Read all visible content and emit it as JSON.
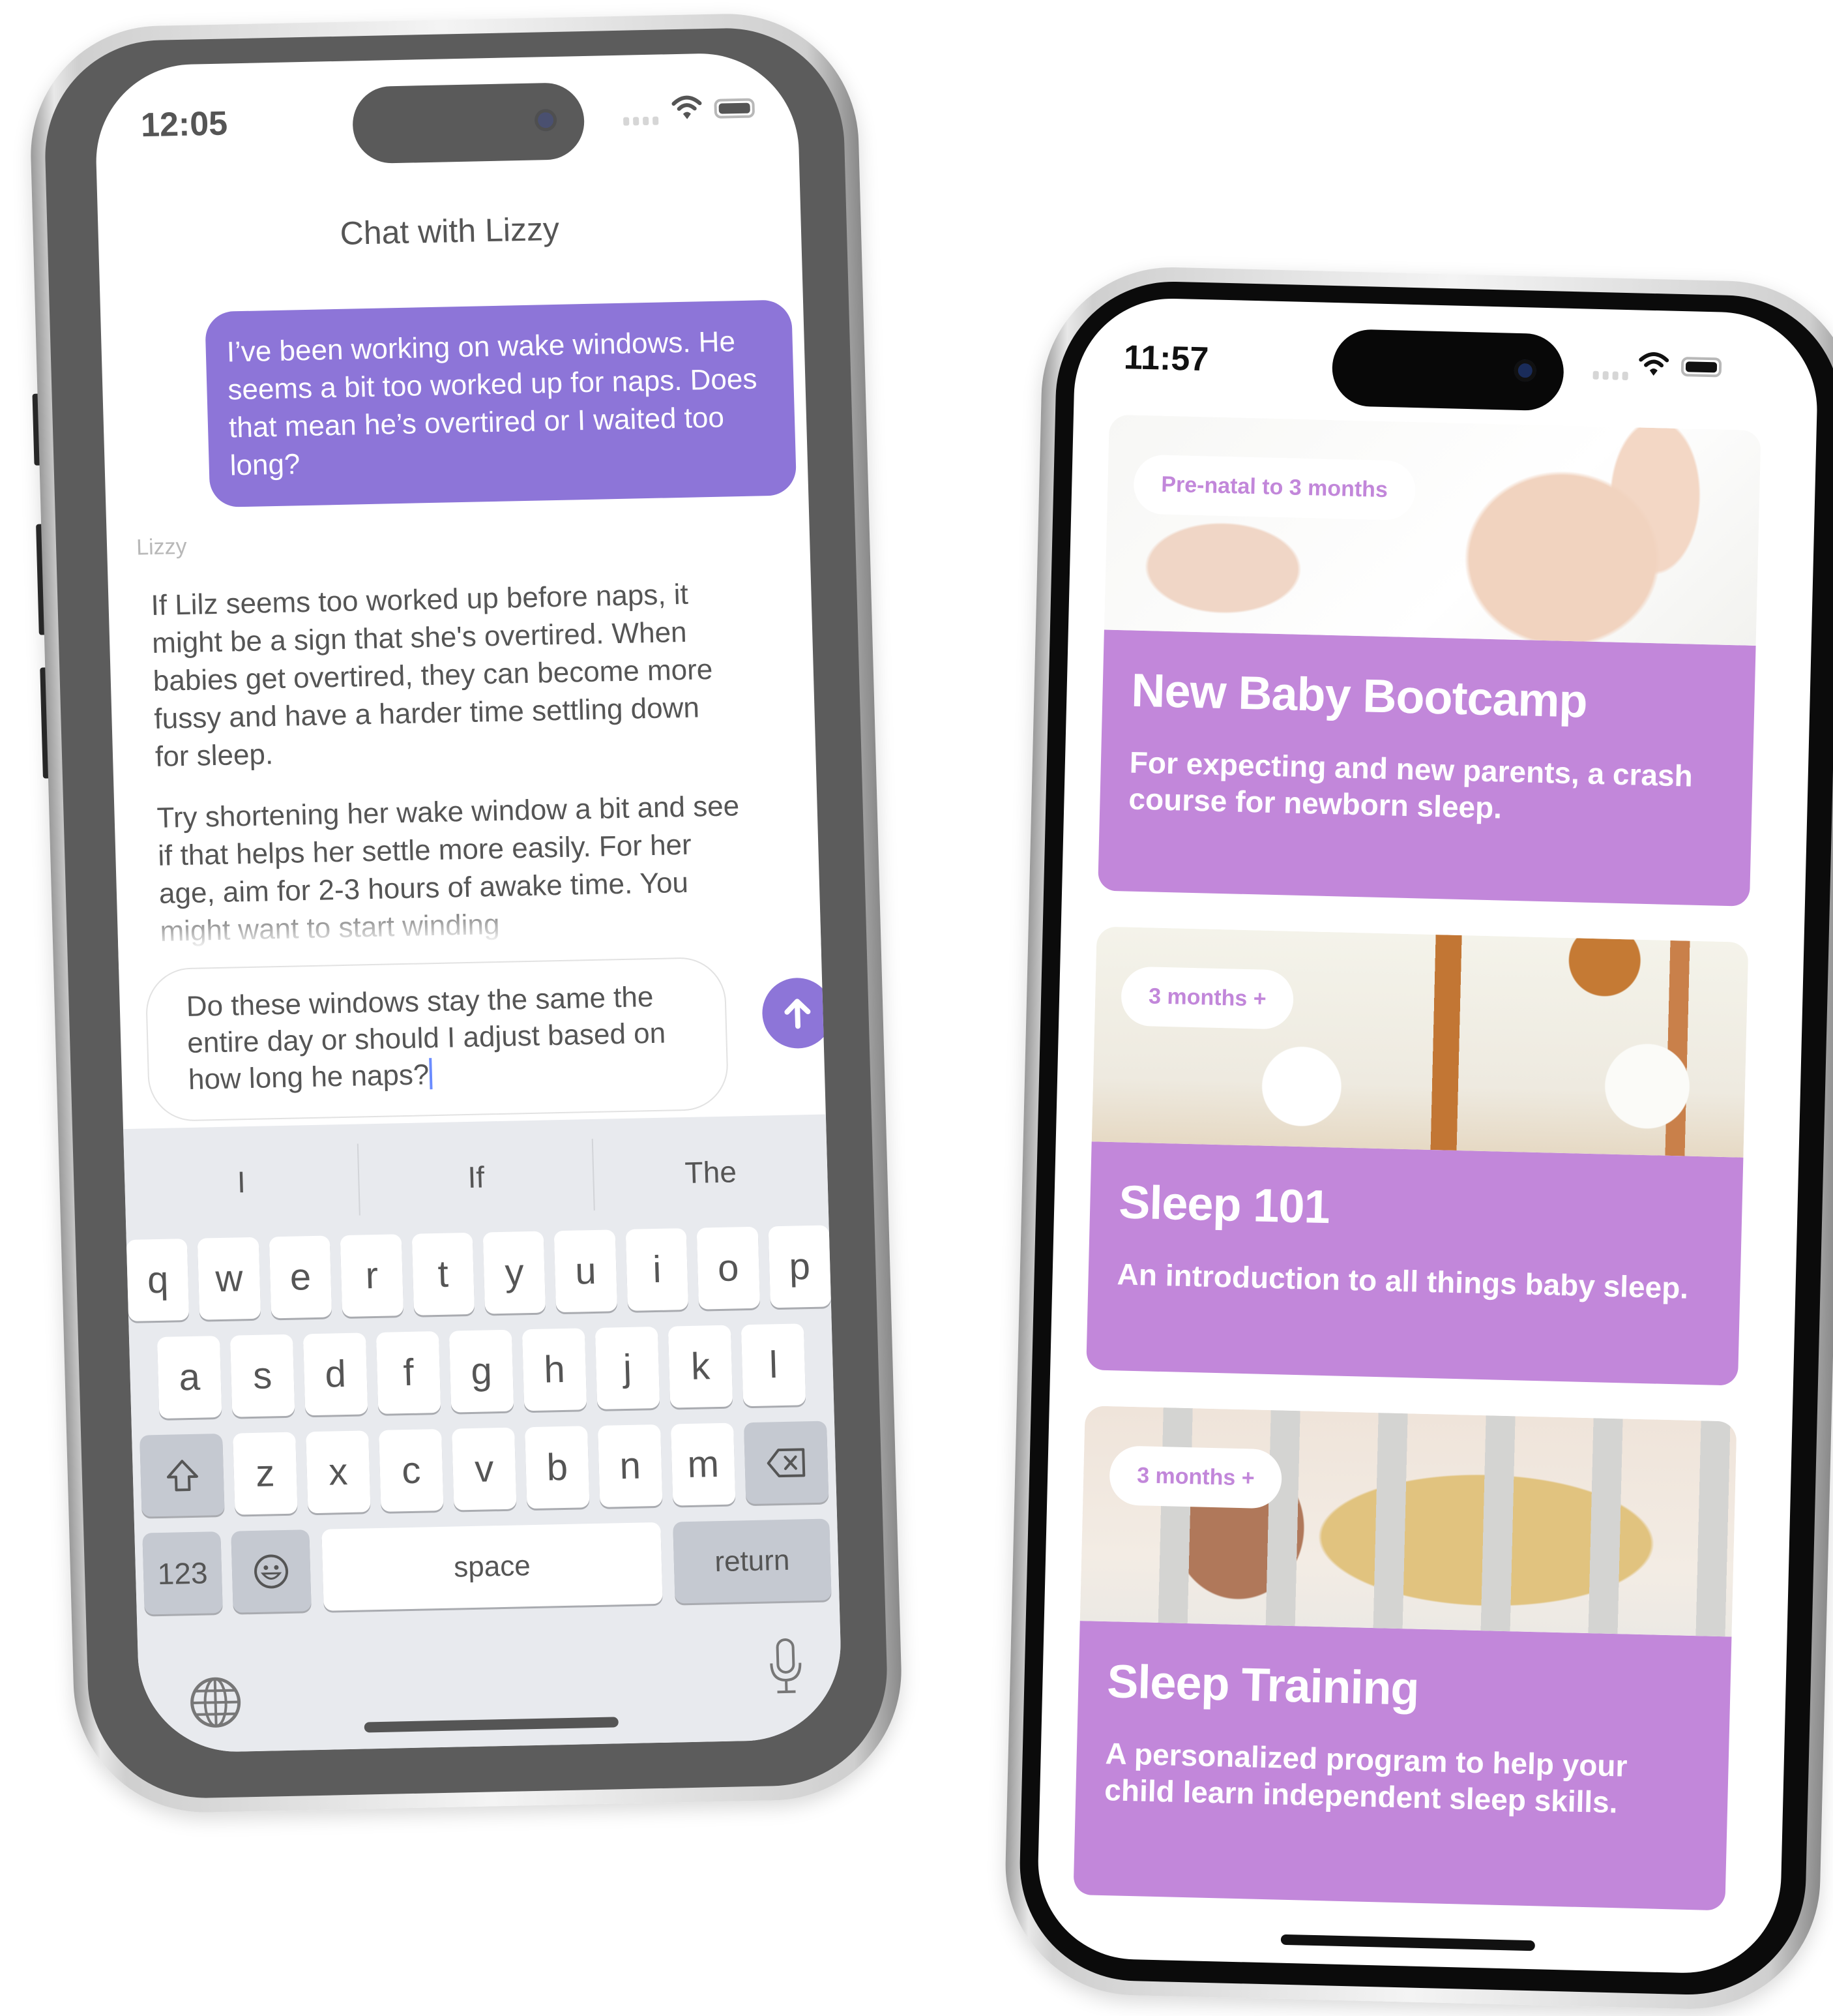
{
  "left_phone": {
    "status_bar": {
      "time": "12:05"
    },
    "header": {
      "title": "Chat with Lizzy"
    },
    "messages": {
      "user": "I’ve been working on wake windows. He seems a bit too worked up for naps. Does that mean he’s overtired or I waited too long?",
      "assistant_name": "Lizzy",
      "assistant_paragraphs": [
        "If Lilz seems too worked up before naps, it might be a sign that she's overtired. When babies get overtired, they can become more fussy and have a harder time settling down for sleep.",
        "Try shortening her wake window a bit and see if that helps her settle more easily. For her age, aim for 2-3 hours of awake time. You might want to start winding"
      ]
    },
    "composer": {
      "value": "Do these windows stay the same the entire day or should I adjust based on how long he naps?",
      "send_icon": "arrow-up-icon"
    },
    "keyboard": {
      "suggestions": [
        "I",
        "If",
        "The"
      ],
      "row1": [
        "q",
        "w",
        "e",
        "r",
        "t",
        "y",
        "u",
        "i",
        "o",
        "p"
      ],
      "row2": [
        "a",
        "s",
        "d",
        "f",
        "g",
        "h",
        "j",
        "k",
        "l"
      ],
      "row3": [
        "z",
        "x",
        "c",
        "v",
        "b",
        "n",
        "m"
      ],
      "numbers_label": "123",
      "space_label": "space",
      "return_label": "return",
      "shift_icon": "shift-icon",
      "delete_icon": "backspace-icon",
      "emoji_icon": "emoji-icon",
      "globe_icon": "globe-icon",
      "mic_icon": "microphone-icon"
    },
    "colors": {
      "accent": "#8d75d8"
    }
  },
  "right_phone": {
    "status_bar": {
      "time": "11:57"
    },
    "programs": [
      {
        "age": "Pre-natal to 3 months",
        "title": "New Baby Bootcamp",
        "description": "For expecting and new parents, a crash course for newborn sleep."
      },
      {
        "age": "3 months +",
        "title": "Sleep 101",
        "description": "An introduction to all things baby sleep."
      },
      {
        "age": "3 months +",
        "title": "Sleep Training",
        "description": "A personalized program to help your child learn independent sleep skills."
      }
    ],
    "colors": {
      "card": "#c287da"
    }
  }
}
